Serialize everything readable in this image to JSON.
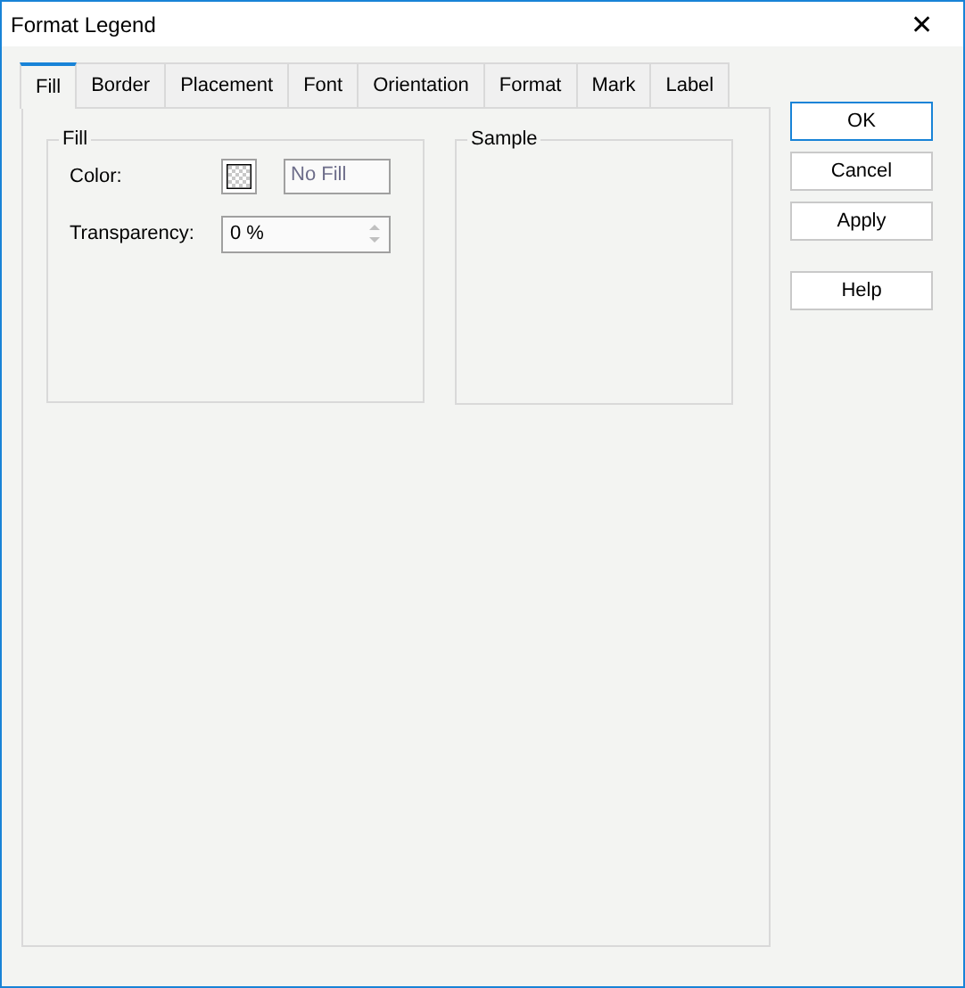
{
  "window": {
    "title": "Format Legend",
    "close": "✕"
  },
  "tabs": [
    {
      "label": "Fill",
      "selected": true
    },
    {
      "label": "Border",
      "selected": false
    },
    {
      "label": "Placement",
      "selected": false
    },
    {
      "label": "Font",
      "selected": false
    },
    {
      "label": "Orientation",
      "selected": false
    },
    {
      "label": "Format",
      "selected": false
    },
    {
      "label": "Mark",
      "selected": false
    },
    {
      "label": "Label",
      "selected": false
    }
  ],
  "fill_group": {
    "title": "Fill",
    "color_label": "Color:",
    "color_value": "No Fill",
    "transparency_label": "Transparency:",
    "transparency_value": "0 %"
  },
  "sample_group": {
    "title": "Sample"
  },
  "buttons": [
    {
      "label": "OK",
      "default": true
    },
    {
      "label": "Cancel",
      "default": false
    },
    {
      "label": "Apply",
      "default": false
    },
    {
      "label": "Help",
      "default": false
    }
  ]
}
